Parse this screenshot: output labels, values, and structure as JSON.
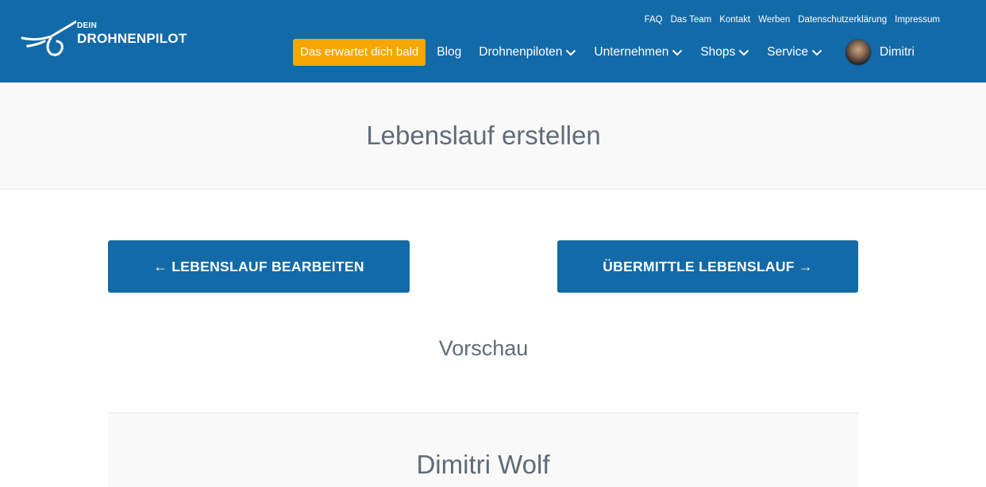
{
  "header": {
    "logo": {
      "line1": "DEIN",
      "line2": "DROHNENPILOT"
    },
    "top_links": [
      "FAQ",
      "Das Team",
      "Kontakt",
      "Werben",
      "Datenschutzerklärung",
      "Impressum"
    ],
    "cta_label": "Das erwartet dich bald",
    "nav": {
      "blog": "Blog",
      "drohnenpiloten": "Drohnenpiloten",
      "unternehmen": "Unternehmen",
      "shops": "Shops",
      "service": "Service"
    },
    "user_name": "Dimitri"
  },
  "page": {
    "title": "Lebenslauf erstellen",
    "edit_button": "← LEBENSLAUF BEARBEITEN",
    "submit_button": "ÜBERMITTLE LEBENSLAUF →",
    "preview_heading": "Vorschau",
    "cv_name": "Dimitri Wolf"
  },
  "colors": {
    "header_bg": "#136aa8",
    "cta_bg": "#f7a600",
    "button_bg": "#136aa8",
    "heading_text": "#5f6b78"
  }
}
